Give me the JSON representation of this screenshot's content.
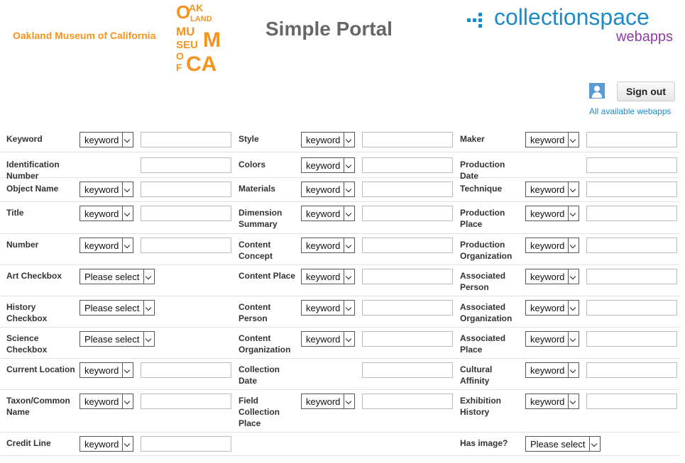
{
  "header": {
    "museum_name": "Oakland Museum of California",
    "logo_lines": [
      "OAK",
      "LAND",
      "MU",
      "M",
      "SEU",
      "OF",
      "CA"
    ],
    "portal_title": "Simple Portal",
    "cs_word": "collectionspace",
    "cs_sub": "webapps",
    "signout_label": "Sign out",
    "all_webapps": "All available webapps"
  },
  "labels": {
    "keyword": "keyword",
    "please": "Please select"
  },
  "rows": [
    {
      "c1": "Keyword",
      "c2": "Style",
      "c3": "Maker"
    },
    {
      "c1": "Identification Number",
      "c2": "Colors",
      "c3": "Production Date"
    },
    {
      "c1": "Object Name",
      "c2": "Materials",
      "c3": "Technique"
    },
    {
      "c1": "Title",
      "c2": "Dimension Summary",
      "c3": "Production Place"
    },
    {
      "c1": "Number",
      "c2": "Content Concept",
      "c3": "Production Organization"
    },
    {
      "c1": "Art Checkbox",
      "c2": "Content Place",
      "c3": "Associated Person"
    },
    {
      "c1": "History Checkbox",
      "c2": "Content Person",
      "c3": "Associated Organization"
    },
    {
      "c1": "Science Checkbox",
      "c2": "Content Organization",
      "c3": "Associated Place"
    },
    {
      "c1": "Current Location",
      "c2": "Collection Date",
      "c3": "Cultural Affinity"
    },
    {
      "c1": "Taxon/Common Name",
      "c2": "Field Collection Place",
      "c3": "Exhibition History"
    },
    {
      "c1": "Credit Line",
      "c2": "",
      "c3": "Has image?"
    }
  ]
}
